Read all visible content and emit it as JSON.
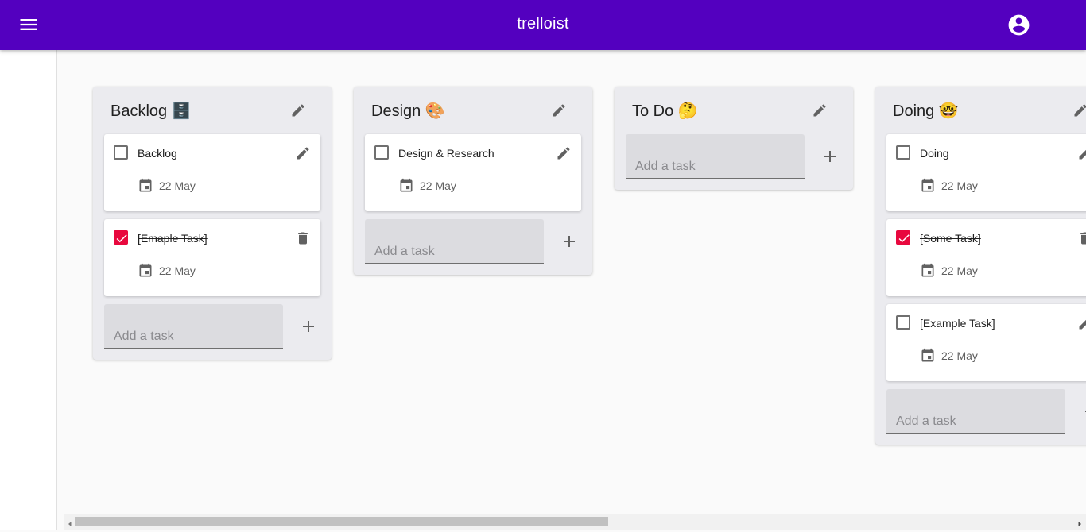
{
  "app": {
    "title": "trelloist"
  },
  "header": {
    "menu_icon": "menu-icon",
    "account_icon": "account-circle-icon",
    "accent": "#5300bf"
  },
  "checked_color": "#e8083e",
  "lists": [
    {
      "title": "Backlog 🗄️",
      "cards": [
        {
          "text": "Backlog",
          "checked": false,
          "date": "22 May"
        },
        {
          "text": "[Emaple Task]",
          "checked": true,
          "date": "22 May"
        }
      ],
      "add_placeholder": "Add a task"
    },
    {
      "title": "Design 🎨",
      "cards": [
        {
          "text": "Design & Research",
          "checked": false,
          "date": "22 May"
        }
      ],
      "add_placeholder": "Add a task"
    },
    {
      "title": "To Do 🤔",
      "cards": [],
      "add_placeholder": "Add a task"
    },
    {
      "title": "Doing 🤓",
      "cards": [
        {
          "text": "Doing",
          "checked": false,
          "date": "22 May"
        },
        {
          "text": "[Some Task]",
          "checked": true,
          "date": "22 May"
        },
        {
          "text": "[Example Task]",
          "checked": false,
          "date": "22 May"
        }
      ],
      "add_placeholder": "Add a task"
    }
  ]
}
